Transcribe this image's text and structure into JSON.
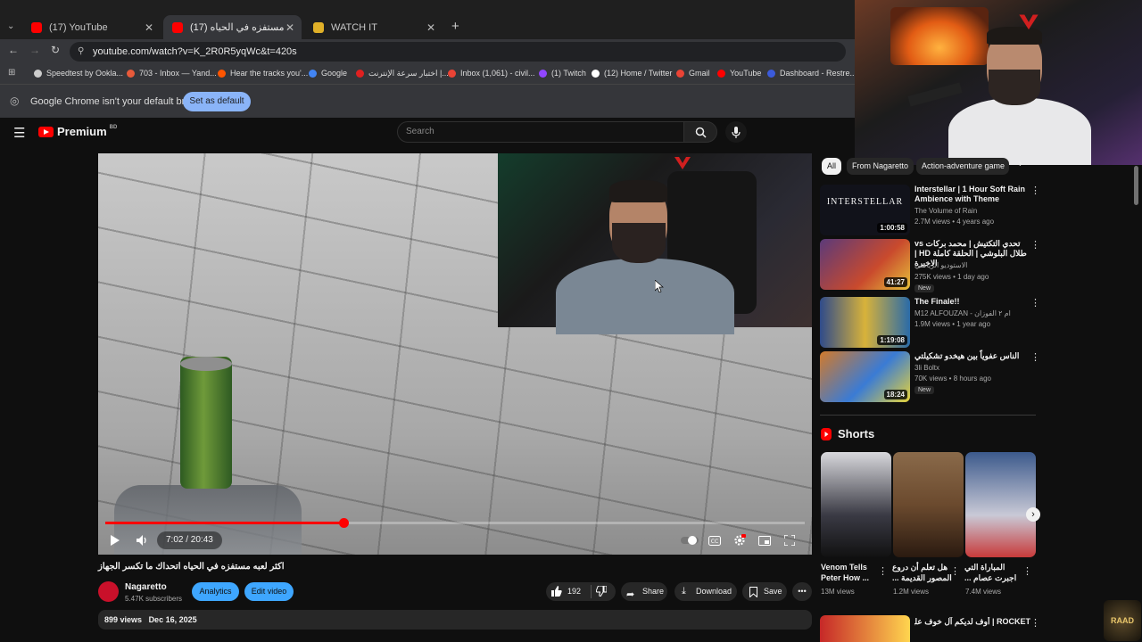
{
  "browser": {
    "tabs": [
      {
        "label": "(17) YouTube",
        "color": "#ff0000"
      },
      {
        "label": "(17) اكثر لعبه مستفزه في الحياه",
        "color": "#ff0000"
      },
      {
        "label": "WATCH IT",
        "color": "#e0b028"
      }
    ],
    "url": "youtube.com/watch?v=K_2R0R5yqWc&t=420s",
    "bookmarks": [
      {
        "label": "Speedtest by Ookla...",
        "color": "#cccccc"
      },
      {
        "label": "703 - Inbox — Yand...",
        "color": "#e85a3a"
      },
      {
        "label": "Hear the tracks you'...",
        "color": "#ff5500"
      },
      {
        "label": "Google",
        "color": "#4285f4"
      },
      {
        "label": "اختبار سرعة الإنترنت |...",
        "color": "#e02020"
      },
      {
        "label": "Inbox (1,061) - civil...",
        "color": "#ea4335"
      },
      {
        "label": "(1) Twitch",
        "color": "#9146ff"
      },
      {
        "label": "(12) Home / Twitter",
        "color": "#ffffff"
      },
      {
        "label": "Gmail",
        "color": "#ea4335"
      },
      {
        "label": "YouTube",
        "color": "#ff0000"
      },
      {
        "label": "Dashboard - Restre...",
        "color": "#3b5bdb"
      }
    ],
    "infobar": {
      "message": "Google Chrome isn't your default browser",
      "button": "Set as default"
    }
  },
  "youtube": {
    "logo": "Premium",
    "logo_badge": "BD",
    "search_placeholder": "Search",
    "player": {
      "current_time": "7:02",
      "duration": "20:43",
      "time_label": "7:02 / 20:43",
      "progress": 0.34
    },
    "video_title": "اكثر لعبه مستفزه في الحياه اتحداك ما تكسر الجهاز",
    "channel": {
      "name": "Nagaretto",
      "subscribers": "5.47K subscribers"
    },
    "buttons": {
      "analytics": "Analytics",
      "edit": "Edit video",
      "likes": "192",
      "share": "Share",
      "download": "Download",
      "save": "Save"
    },
    "meta": {
      "views": "899 views",
      "date": "Dec 16, 2025"
    }
  },
  "sidebar": {
    "chips": [
      "All",
      "From Nagaretto",
      "Action-adventure game"
    ],
    "recommended": [
      {
        "title": "Interstellar | 1 Hour Soft Rain Ambience with Theme",
        "channel": "The Volume of Rain",
        "info": "2.7M views • 4 years ago",
        "duration": "1:00:58",
        "new": "",
        "thumb_color": "#11121a",
        "thumb_text": "INTERSTELLAR"
      },
      {
        "title": "تحدي التكتيش | محمد بركات vs طلال البلوشي | الحلقة كاملة HD | الاخيرة",
        "channel": "الاستوديو الرياضي",
        "info": "275K views • 1 day ago",
        "duration": "41:27",
        "new": "New",
        "thumb_color": "#5b3a7a",
        "thumb_text": ""
      },
      {
        "title": "The Finale!!",
        "channel": "M12 ALFOUZAN - ام ٢ الفوزان",
        "info": "1.9M views • 1 year ago",
        "duration": "1:19:08",
        "new": "",
        "thumb_color": "#2f4b8a",
        "thumb_text": ""
      },
      {
        "title": "الناس عفوياً بين هيخدو تشكيلتي",
        "channel": "3li Boltx",
        "info": "70K views • 8 hours ago",
        "duration": "18:24",
        "new": "New",
        "thumb_color": "#d27a2a",
        "thumb_text": ""
      }
    ],
    "shorts_heading": "Shorts",
    "shorts": [
      {
        "title": "Venom Tells Peter How ...",
        "views": "13M views",
        "color": "#3a3a44"
      },
      {
        "title": "هل تعلم أن دروع المصور القديمة ...",
        "views": "1.2M views",
        "color": "#6b4a2e"
      },
      {
        "title": "المباراة التي اجبرت عصام ...",
        "views": "7.4M views",
        "color": "#3c5a8c"
      }
    ],
    "next_item": "ROCKET | أوف لديكم آل خوف عليكم 😂"
  },
  "overlay": {
    "watermark": "RAAD"
  }
}
